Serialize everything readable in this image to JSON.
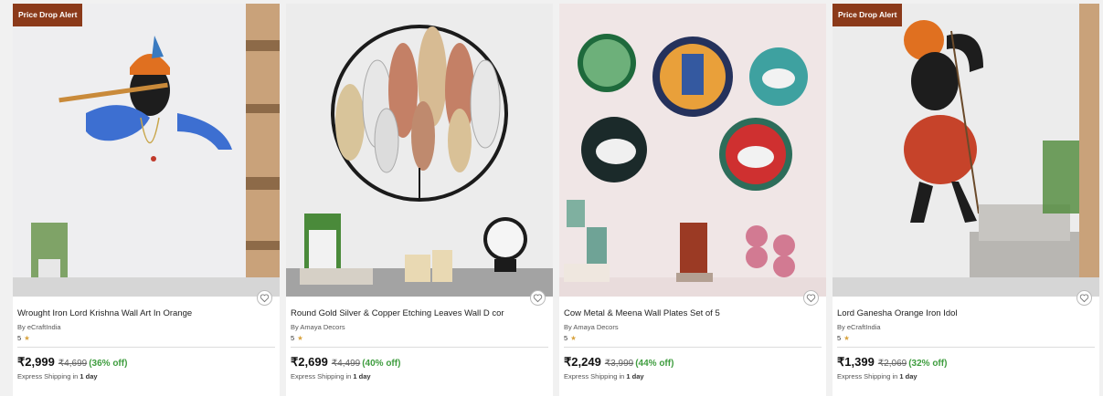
{
  "products": [
    {
      "badge": "Price Drop Alert",
      "title": "Wrought Iron Lord Krishna Wall Art In Orange",
      "brand": "By eCraftIndia",
      "rating": "5",
      "price": "₹2,999",
      "mrp": "₹4,699",
      "discount": "(36% off)",
      "shipping_prefix": "Express Shipping in",
      "shipping_days": "1 day"
    },
    {
      "badge": "",
      "title": "Round Gold Silver & Copper Etching Leaves Wall D cor",
      "brand": "By Amaya Decors",
      "rating": "5",
      "price": "₹2,699",
      "mrp": "₹4,499",
      "discount": "(40% off)",
      "shipping_prefix": "Express Shipping in",
      "shipping_days": "1 day"
    },
    {
      "badge": "",
      "title": "Cow Metal & Meena Wall Plates Set of 5",
      "brand": "By Amaya Decors",
      "rating": "5",
      "price": "₹2,249",
      "mrp": "₹3,999",
      "discount": "(44% off)",
      "shipping_prefix": "Express Shipping in",
      "shipping_days": "1 day"
    },
    {
      "badge": "Price Drop Alert",
      "title": "Lord Ganesha Orange Iron Idol",
      "brand": "By eCraftIndia",
      "rating": "5",
      "price": "₹1,399",
      "mrp": "₹2,069",
      "discount": "(32% off)",
      "shipping_prefix": "Express Shipping in",
      "shipping_days": "1 day"
    }
  ],
  "colors": {
    "badge": "#8b3a1a",
    "discount": "#3f9d3f",
    "star": "#d9a441"
  },
  "icons": {
    "wishlist": "heart-outline-icon",
    "rating": "star-icon"
  }
}
